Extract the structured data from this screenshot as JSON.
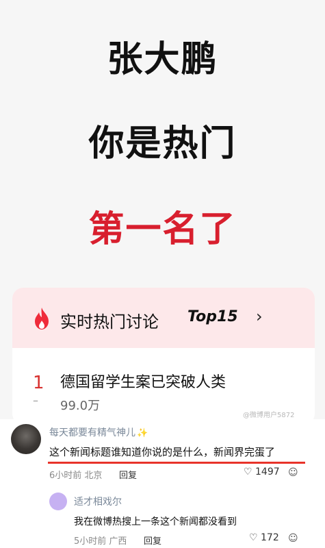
{
  "headline": {
    "line1": "张大鹏",
    "line2": "你是热门",
    "line3": "第一名了"
  },
  "hot_card": {
    "title": "实时热门讨论",
    "top_label": "Top15",
    "chevron": "›",
    "items": [
      {
        "rank": "1",
        "rank_change": "–",
        "title": "德国留学生案已突破人类",
        "count": "99.0万"
      }
    ]
  },
  "watermark": "@微博用户5872",
  "comments": [
    {
      "username": "每天都要有精气神儿",
      "text": "这个新闻标题谁知道你说的是什么，新闻界完蛋了",
      "meta": "6小时前 北京",
      "reply_label": "回复",
      "likes": "♡ 1497"
    },
    {
      "username": "适才相戏尔",
      "text": "我在微博热搜上一条这个新闻都没看到",
      "meta": "5小时前 广西",
      "reply_label": "回复",
      "likes": "♡ 172"
    }
  ],
  "colors": {
    "accent_red": "#d81f2e",
    "card_header_bg": "#fde8ea",
    "underline": "#e8332a",
    "username": "#7a8899"
  },
  "icons": [
    "fire-icon",
    "chevron-right-icon",
    "sparkle-icon",
    "heart-icon",
    "emoji-icon"
  ]
}
